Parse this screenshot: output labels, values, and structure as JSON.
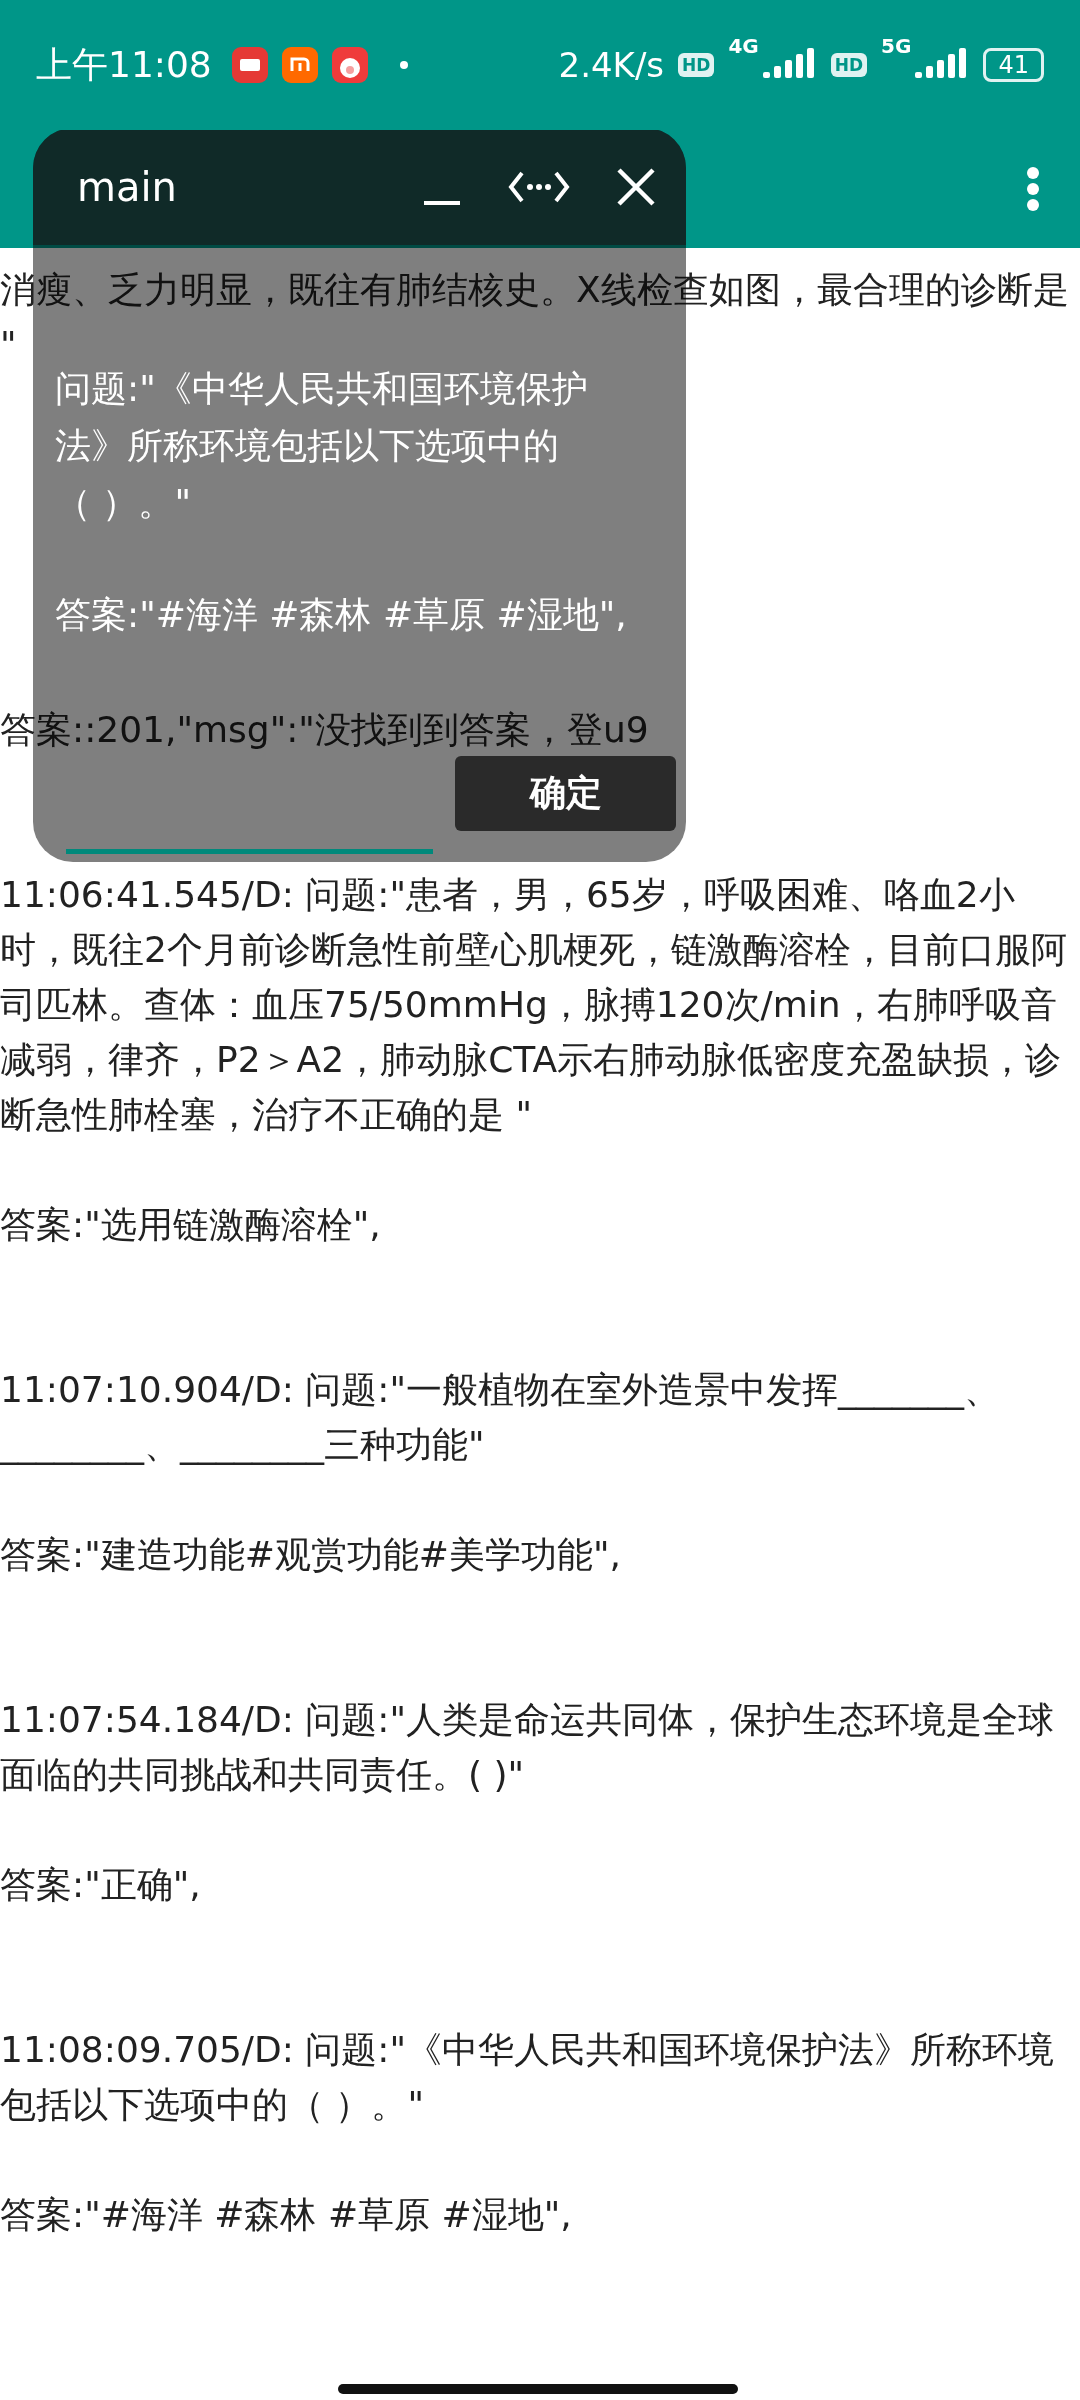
{
  "status_bar": {
    "time": "上午11:08",
    "net_speed": "2.4K/s",
    "badges": [
      "HD",
      "4G",
      "HD",
      "5G"
    ],
    "battery": "41"
  },
  "log": [
    {
      "question": "消瘦、乏力明显，既往有肺结核史。X线检查如图，最合理的诊断是 \""
    },
    {
      "answer": "答案::201,\"msg\":\"没找到到答案，登u9"
    },
    {
      "question": "11:06:41.545/D: 问题:\"患者，男，65岁，呼吸困难、咯血2小时，既往2个月前诊断急性前壁心肌梗死，链激酶溶栓，目前口服阿司匹林。查体：血压75/50mmHg，脉搏120次/min，右肺呼吸音减弱，律齐，P2＞A2，肺动脉CTA示右肺动脉低密度充盈缺损，诊断急性肺栓塞，治疗不正确的是 \"",
      "answer": "答案:\"选用链激酶溶栓\","
    },
    {
      "question": "11:07:10.904/D: 问题:\"一般植物在室外造景中发挥_______、________、________三种功能\"",
      "answer": "答案:\"建造功能#观赏功能#美学功能\","
    },
    {
      "question": "11:07:54.184/D: 问题:\"人类是命运共同体，保护生态环境是全球面临的共同挑战和共同责任。( )\"",
      "answer": "答案:\"正确\","
    },
    {
      "question": "11:08:09.705/D: 问题:\"《中华人民共和国环境保护法》所称环境包括以下选项中的（ ）。\"",
      "answer": "答案:\"#海洋 #森林 #草原 #湿地\","
    }
  ],
  "floating_window": {
    "title": "main",
    "question": "问题:\"《中华人民共和国环境保护法》所称环境包括以下选项中的（ ）。\"",
    "answer": "答案:\"#海洋 #森林 #草原 #湿地\",",
    "button": "确定"
  }
}
